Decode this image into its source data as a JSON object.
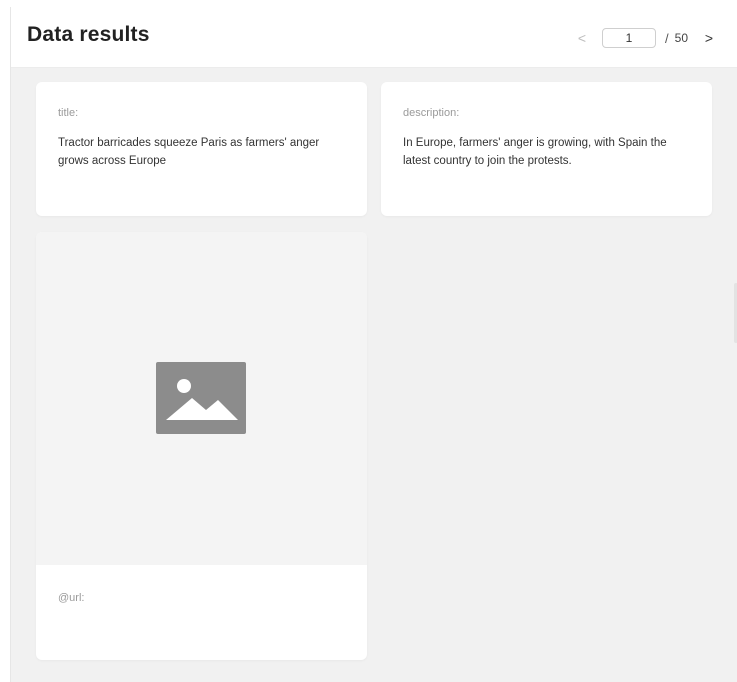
{
  "header": {
    "title": "Data results"
  },
  "pagination": {
    "prev_symbol": "<",
    "current_page": "1",
    "separator": "/",
    "total_pages": "50",
    "next_symbol": ">"
  },
  "cards": {
    "title_card": {
      "label": "title:",
      "value": "Tractor barricades squeeze Paris as farmers' anger grows across Europe"
    },
    "description_card": {
      "label": "description:",
      "value": "In Europe, farmers' anger is growing, with Spain the latest country to join the protests."
    },
    "image_card": {
      "image_icon": "image-placeholder-icon",
      "url_label": "@url:"
    }
  }
}
